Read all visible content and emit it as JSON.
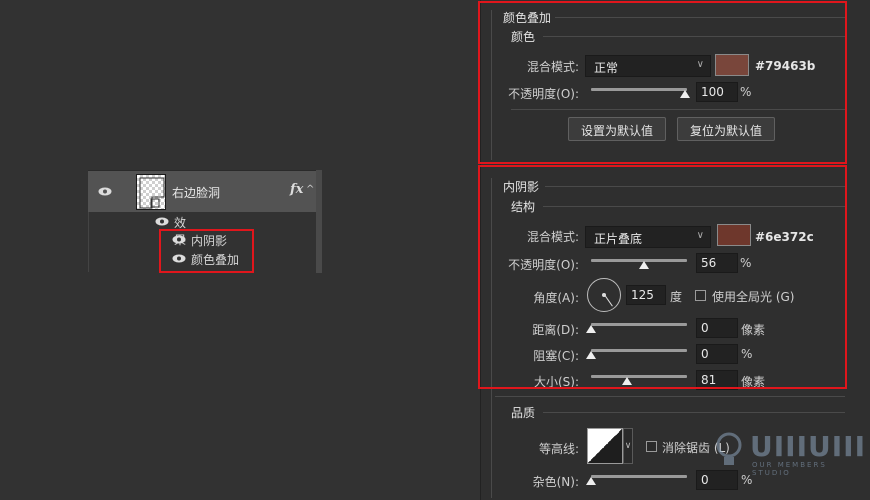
{
  "layers": {
    "layer_name": "右边脸洞",
    "fx_label": "fx",
    "collapse_glyph": "^",
    "effects_label": "效果",
    "effects": [
      {
        "label": "内阴影"
      },
      {
        "label": "颜色叠加"
      }
    ],
    "icons": {
      "visibility": "eye-icon",
      "fx": "fx-icon",
      "collapse": "chevron-up-icon"
    }
  },
  "color_overlay": {
    "title": "颜色叠加",
    "group_title": "颜色",
    "blend_label": "混合模式:",
    "blend_value": "正常",
    "color_hex": "#79463b",
    "opacity_label": "不透明度(O):",
    "opacity_value": "100",
    "opacity_percent": 100,
    "unit_percent": "%",
    "set_default_button": "设置为默认值",
    "reset_default_button": "复位为默认值"
  },
  "inner_shadow": {
    "title": "内阴影",
    "structure_title": "结构",
    "blend_label": "混合模式:",
    "blend_value": "正片叠底",
    "color_hex": "#6e372c",
    "opacity_label": "不透明度(O):",
    "opacity_value": "56",
    "opacity_percent": 56,
    "unit_percent": "%",
    "angle_label": "角度(A):",
    "angle_value": "125",
    "angle_unit": "度",
    "global_light_label": "使用全局光 (G)",
    "distance_label": "距离(D):",
    "distance_value": "0",
    "distance_unit": "像素",
    "choke_label": "阻塞(C):",
    "choke_value": "0",
    "choke_unit": "%",
    "size_label": "大小(S):",
    "size_value": "81",
    "size_unit": "像素",
    "quality_title": "品质",
    "contour_label": "等高线:",
    "anti_alias_label": "消除锯齿 (L)",
    "noise_label": "杂色(N):",
    "noise_value": "0",
    "noise_unit": "%"
  },
  "colors": {
    "accent_highlight": "#e0161c",
    "overlay_swatch": "#79463b",
    "shadow_swatch": "#6e372c"
  },
  "watermark": {
    "text": "UIIIUIII",
    "sub": "OUR MEMBERS STUDIO"
  }
}
